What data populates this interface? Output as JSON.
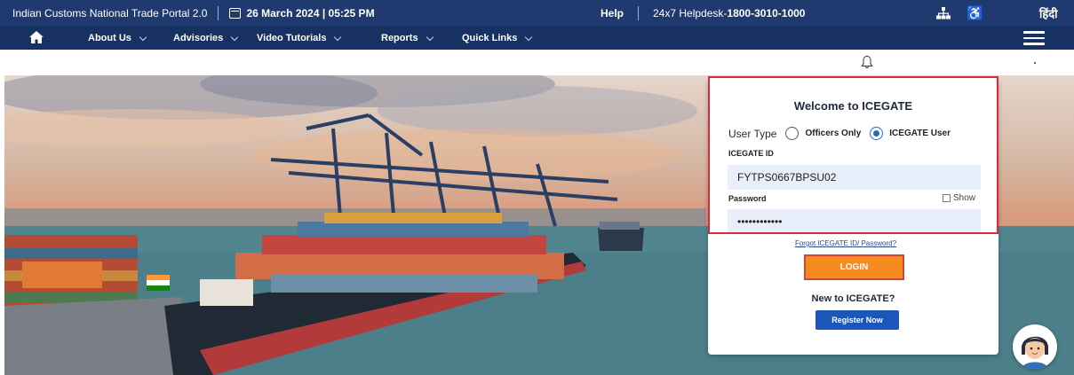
{
  "topbar": {
    "portal_title": "Indian Customs National Trade Portal 2.0",
    "datetime": "26 March 2024 | 05:25 PM",
    "help": "Help",
    "helpdesk_label": "24x7 Helpdesk-",
    "helpdesk_number": "1800-3010-1000",
    "language": "हिंदी",
    "icons": [
      "calendar-icon",
      "sitemap-icon",
      "accessibility-icon"
    ]
  },
  "nav": {
    "items": [
      {
        "label": "About Us"
      },
      {
        "label": "Advisories"
      },
      {
        "label": "Video Tutorials"
      },
      {
        "label": "Reports"
      },
      {
        "label": "Quick Links"
      }
    ],
    "icons": [
      "home-icon",
      "hamburger-menu-icon",
      "bell-icon"
    ]
  },
  "login": {
    "welcome": "Welcome to ICEGATE",
    "user_type_label": "User Type",
    "options": [
      "Officers Only",
      "ICEGATE User"
    ],
    "selected_option": "ICEGATE User",
    "id_label": "ICEGATE ID",
    "id_value": "FYTPS0667BPSU02",
    "password_label": "Password",
    "password_value": "••••••••••••",
    "show_label": "Show",
    "forgot": "Forgot ICEGATE ID/ Password?",
    "login_button": "LOGIN",
    "new_user": "New to ICEGATE?",
    "register_button": "Register Now"
  },
  "colors": {
    "topbar": "#1f3a6e",
    "navbar": "#173163",
    "login_button": "#f58a1f",
    "highlight_border": "#d32f3a",
    "register_button": "#1c56b8"
  }
}
